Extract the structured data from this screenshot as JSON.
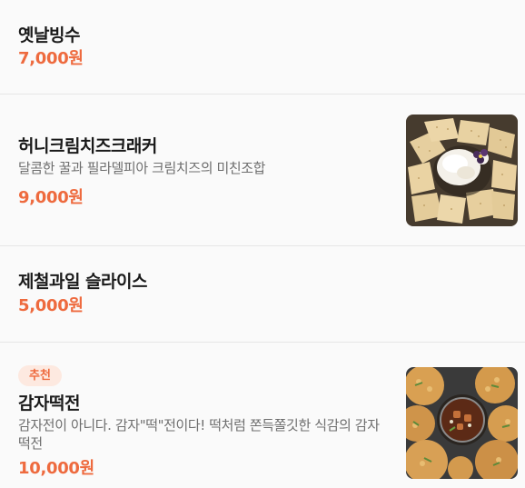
{
  "menu": {
    "items": [
      {
        "name": "옛날빙수",
        "price": "7,000원"
      },
      {
        "name": "허니크림치즈크래커",
        "description": "달콤한 꿀과 필라델피아 크림치즈의 미친조합",
        "price": "9,000원",
        "image": "cracker-cheese-photo"
      },
      {
        "name": "제철과일 슬라이스",
        "price": "5,000원"
      },
      {
        "badge": "추천",
        "name": "감자떡전",
        "description": "감자전이 아니다. 감자\"떡\"전이다! 떡처럼 쫀득쫄깃한 식감의 감자떡전",
        "price": "10,000원",
        "image": "potato-pancake-photo"
      }
    ]
  },
  "colors": {
    "price": "#ee6a3e",
    "badge_bg": "#fde9e0",
    "name": "#1a1a1a",
    "description": "#6e6e6e",
    "background": "#fafafa"
  }
}
